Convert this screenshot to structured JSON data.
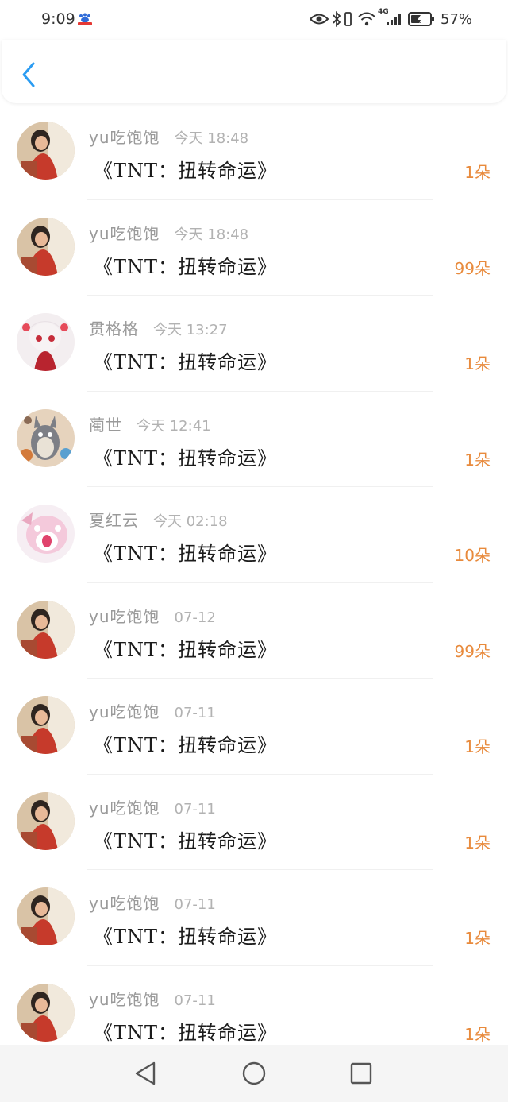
{
  "status_bar": {
    "time": "9:09",
    "battery_percent": "57%",
    "network_label": "4G",
    "icons": [
      "baidu-app-icon",
      "eye-icon",
      "bluetooth-icon",
      "vibrate-icon",
      "wifi-icon",
      "signal-icon",
      "battery-charging-icon"
    ]
  },
  "header": {
    "back_icon": "chevron-left-icon",
    "accent_color": "#2b9cf2"
  },
  "gifts": [
    {
      "sender": "yu吃饱饱",
      "time": "今天 18:48",
      "gift": "《TNT：扭转命运》",
      "count": "1朵",
      "avatar": "avatar-yu"
    },
    {
      "sender": "yu吃饱饱",
      "time": "今天 18:48",
      "gift": "《TNT：扭转命运》",
      "count": "99朵",
      "avatar": "avatar-yu"
    },
    {
      "sender": "贯格格",
      "time": "今天 13:27",
      "gift": "《TNT：扭转命运》",
      "count": "1朵",
      "avatar": "avatar-doll"
    },
    {
      "sender": "蔺世",
      "time": "今天 12:41",
      "gift": "《TNT：扭转命运》",
      "count": "1朵",
      "avatar": "avatar-totoro"
    },
    {
      "sender": "夏红云",
      "time": "今天 02:18",
      "gift": "《TNT：扭转命运》",
      "count": "10朵",
      "avatar": "avatar-pink"
    },
    {
      "sender": "yu吃饱饱",
      "time": "07-12",
      "gift": "《TNT：扭转命运》",
      "count": "99朵",
      "avatar": "avatar-yu"
    },
    {
      "sender": "yu吃饱饱",
      "time": "07-11",
      "gift": "《TNT：扭转命运》",
      "count": "1朵",
      "avatar": "avatar-yu"
    },
    {
      "sender": "yu吃饱饱",
      "time": "07-11",
      "gift": "《TNT：扭转命运》",
      "count": "1朵",
      "avatar": "avatar-yu"
    },
    {
      "sender": "yu吃饱饱",
      "time": "07-11",
      "gift": "《TNT：扭转命运》",
      "count": "1朵",
      "avatar": "avatar-yu"
    },
    {
      "sender": "yu吃饱饱",
      "time": "07-11",
      "gift": "《TNT：扭转命运》",
      "count": "1朵",
      "avatar": "avatar-yu"
    }
  ],
  "colors": {
    "count": "#e88a3c",
    "sender": "#9a9a9a",
    "gift_text": "#1c1c1c"
  },
  "nav_bar": {
    "icons": [
      "back-triangle-icon",
      "home-circle-icon",
      "recents-square-icon"
    ]
  }
}
